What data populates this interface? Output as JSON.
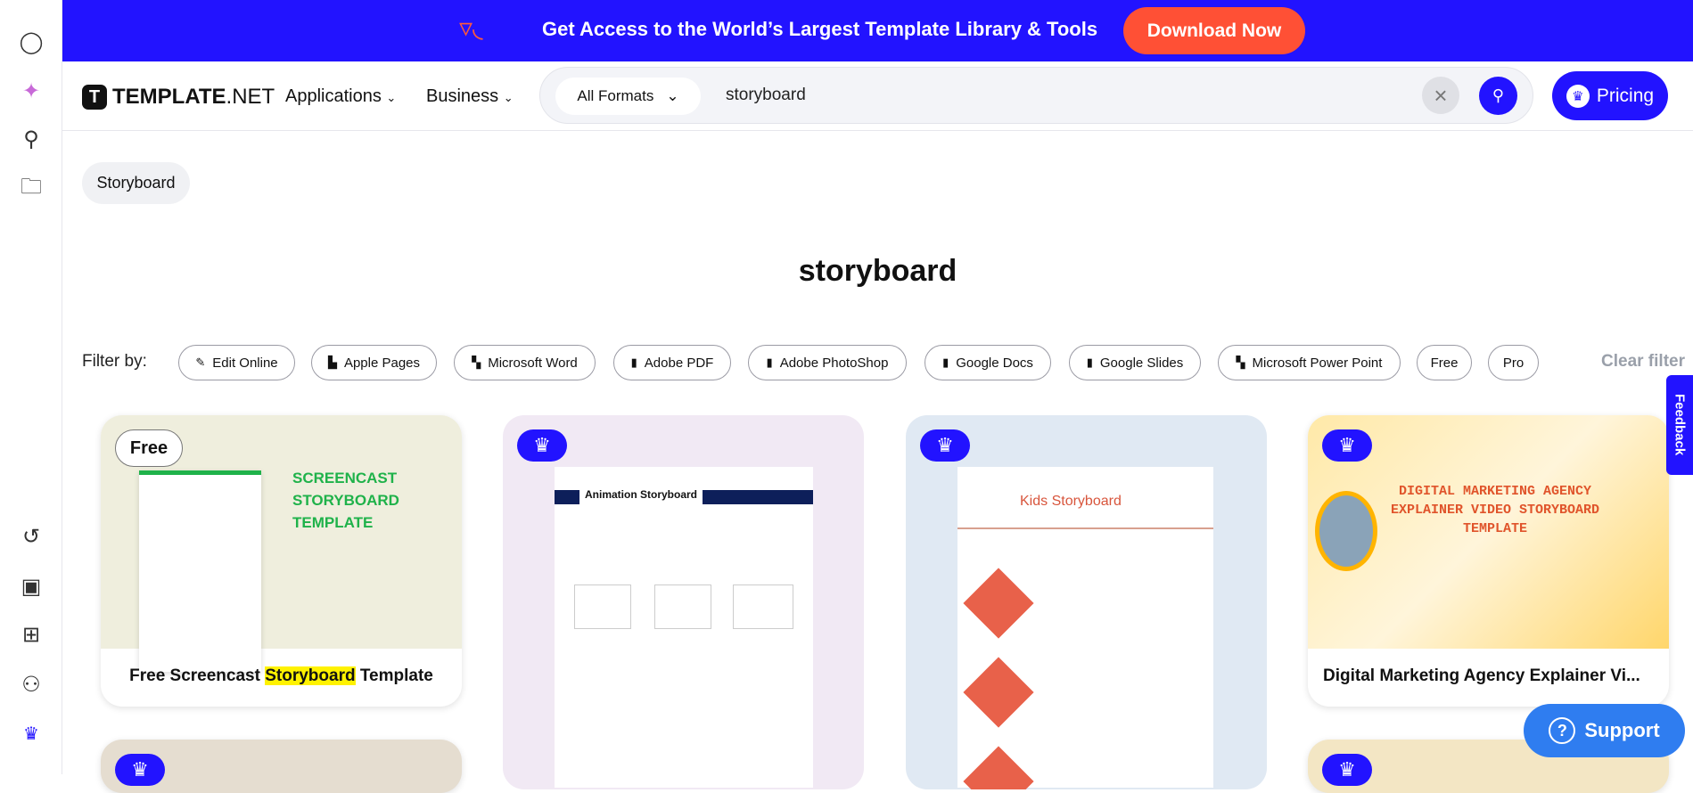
{
  "colors": {
    "brand": "#2213ff",
    "download": "#ff5035",
    "support": "#2f7df0",
    "highlight": "#fff200"
  },
  "sidebar": {
    "icons": [
      "user-icon",
      "ai-sparkle-icon",
      "search-icon",
      "folder-icon",
      "history-icon",
      "profile-card-icon",
      "layout-icon",
      "team-icon",
      "crown-icon"
    ]
  },
  "banner": {
    "text": "Get Access to the World’s Largest Template Library & Tools",
    "button": "Download Now"
  },
  "header": {
    "brand": "TEMPLATE",
    "brand_suffix": ".NET",
    "nav": [
      "Applications",
      "Business"
    ],
    "format_select": "All Formats",
    "search_value": "storyboard",
    "pricing": "Pricing"
  },
  "breadcrumb_chip": "Storyboard",
  "page_title": "storyboard",
  "filters": {
    "label": "Filter by:",
    "items": [
      "Edit Online",
      "Apple Pages",
      "Microsoft Word",
      "Adobe PDF",
      "Adobe PhotoShop",
      "Google Docs",
      "Google Slides",
      "Microsoft Power Point",
      "Free",
      "Pro"
    ],
    "clear": "Clear filter"
  },
  "cards": [
    {
      "badge": "Free",
      "title_pre": "Free Screencast ",
      "title_hl": "Storyboard",
      "title_post": " Template",
      "preview": {
        "heading": "SCREENCAST STORYBOARD TEMPLATE"
      }
    },
    {
      "badge": "pro",
      "title": "",
      "preview": {
        "heading": "Animation Storyboard"
      }
    },
    {
      "badge": "pro",
      "title": "",
      "preview": {
        "heading": "Kids Storyboard"
      }
    },
    {
      "badge": "pro",
      "title": "Digital Marketing Agency Explainer Vi...",
      "preview": {
        "heading": "DIGITAL MARKETING AGENCY EXPLAINER VIDEO STORYBOARD TEMPLATE"
      }
    }
  ],
  "feedback": "Feedback",
  "support": "Support"
}
